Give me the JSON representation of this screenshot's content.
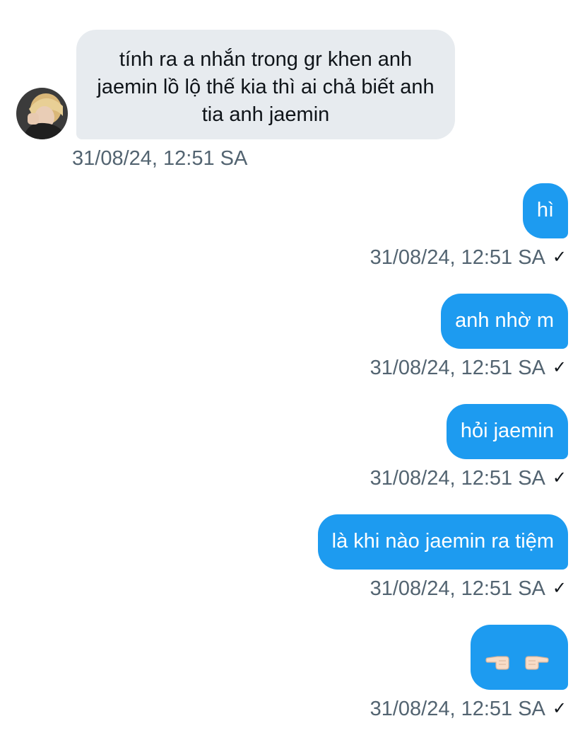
{
  "thread": {
    "incoming": [
      {
        "text": "tính ra a nhắn trong gr khen anh jaemin lồ lộ thế kia thì ai chả biết anh tia anh jaemin",
        "timestamp": "31/08/24, 12:51 SA"
      }
    ],
    "outgoing": [
      {
        "text": "hì",
        "timestamp": "31/08/24, 12:51 SA",
        "status": "✓"
      },
      {
        "text": "anh nhờ m",
        "timestamp": "31/08/24, 12:51 SA",
        "status": "✓"
      },
      {
        "text": "hỏi jaemin",
        "timestamp": "31/08/24, 12:51 SA",
        "status": "✓"
      },
      {
        "text": "là khi nào jaemin ra tiệm",
        "timestamp": "31/08/24, 12:51 SA",
        "status": "✓"
      },
      {
        "emoji": [
          "pointing-left-hand-icon",
          "pointing-right-hand-icon"
        ],
        "timestamp": "31/08/24, 12:51 SA",
        "status": "✓"
      }
    ]
  },
  "colors": {
    "incoming_bubble": "#e7ebef",
    "outgoing_bubble": "#1d9bf0",
    "timestamp": "#536471"
  }
}
